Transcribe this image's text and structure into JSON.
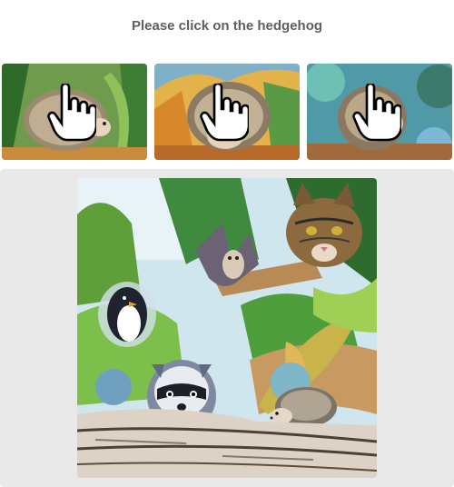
{
  "captcha": {
    "instruction": "Please click on the hedgehog",
    "example_images": [
      {
        "subject": "hedgehog",
        "overlay_icon": "hand-pointer-cursor"
      },
      {
        "subject": "hedgehog",
        "overlay_icon": "hand-pointer-cursor"
      },
      {
        "subject": "hedgehog",
        "overlay_icon": "hand-pointer-cursor"
      }
    ],
    "challenge_image": {
      "scene": "watercolor jungle",
      "animals": [
        "tabby-cat",
        "bat",
        "penguin",
        "raccoon",
        "hedgehog"
      ]
    }
  },
  "colors": {
    "instruction_text": "#5f5f5f",
    "panel_background": "#e9e9e9",
    "page_background": "#ffffff"
  }
}
